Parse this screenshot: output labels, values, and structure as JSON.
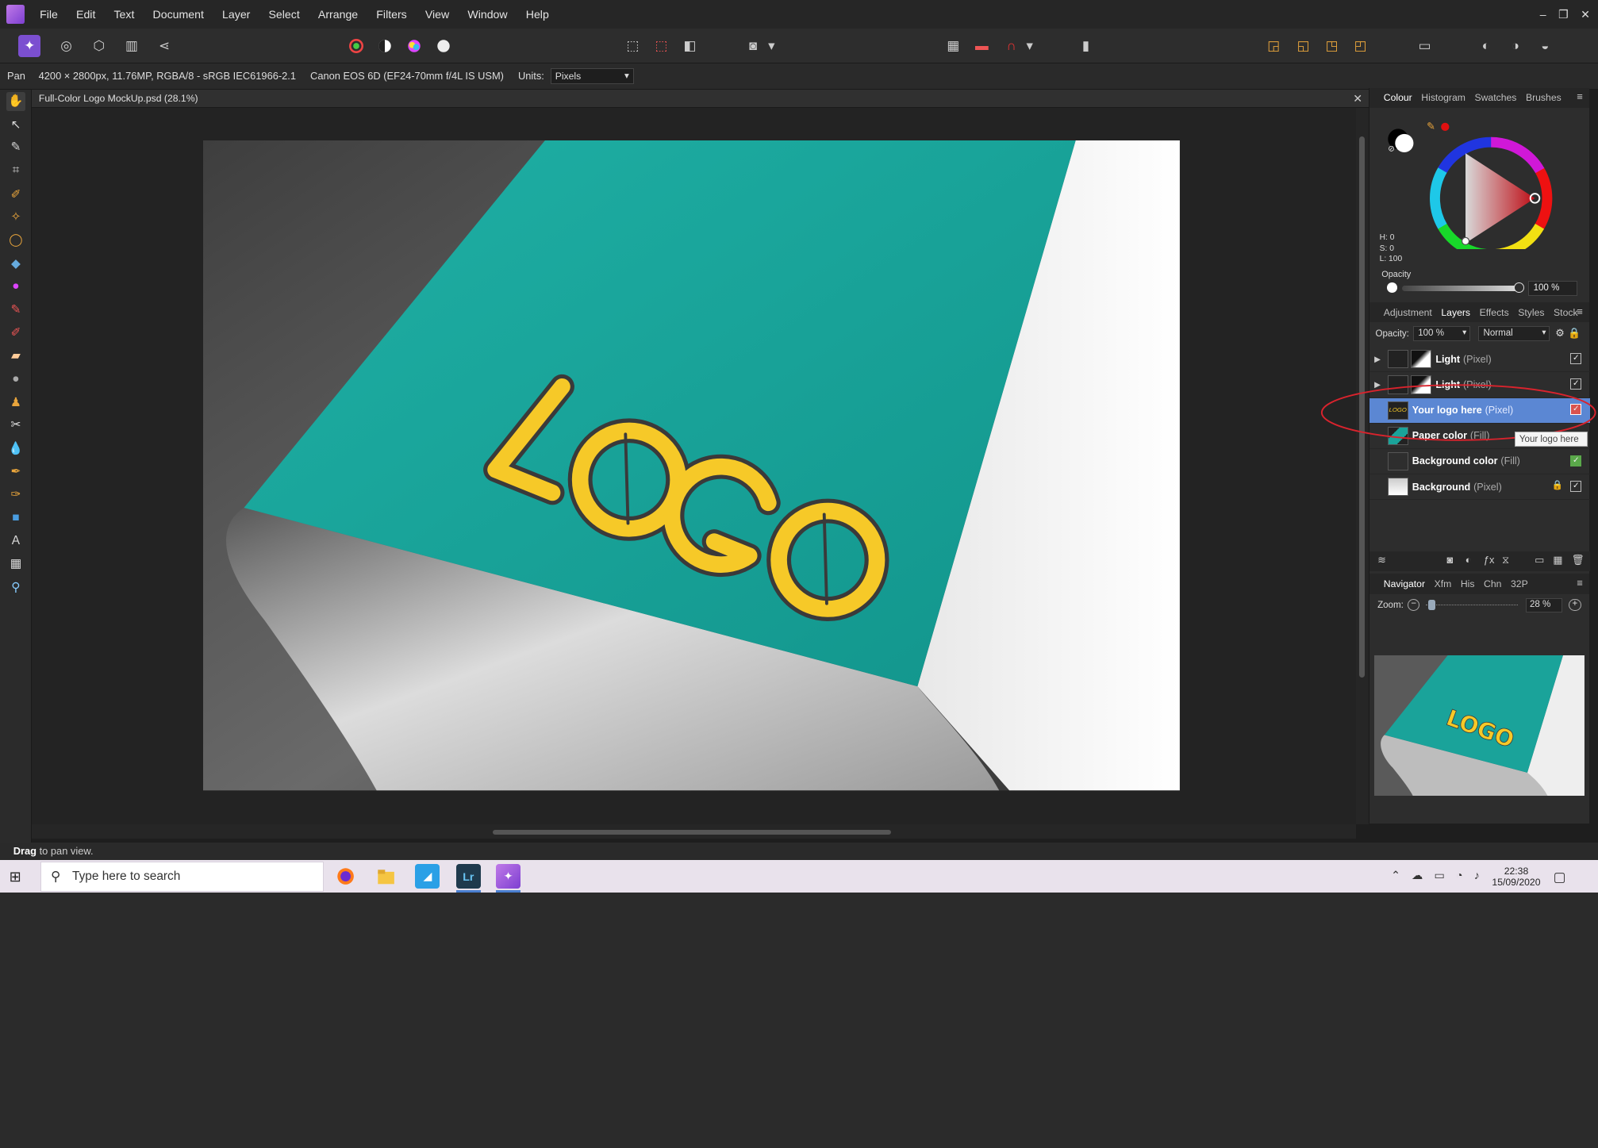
{
  "menu": [
    "File",
    "Edit",
    "Text",
    "Document",
    "Layer",
    "Select",
    "Arrange",
    "Filters",
    "View",
    "Window",
    "Help"
  ],
  "window_controls": [
    "–",
    "❐",
    "✕"
  ],
  "context": {
    "tool": "Pan",
    "doc_info": "4200 × 2800px, 11.76MP, RGBA/8 - sRGB IEC61966-2.1",
    "camera": "Canon EOS 6D (EF24-70mm f/4L IS USM)",
    "units_label": "Units:",
    "units_value": "Pixels"
  },
  "document": {
    "tab_title": "Full-Color Logo MockUp.psd (28.1%)",
    "close": "✕"
  },
  "canvas": {
    "logo_text": "LOGO",
    "paper_color": "#1aa39a",
    "logo_color": "#f6c928"
  },
  "colour_panel": {
    "tabs": [
      "Colour",
      "Histogram",
      "Swatches",
      "Brushes"
    ],
    "active_tab": "Colour",
    "h": "H: 0",
    "s": "S: 0",
    "l": "L: 100",
    "opacity_label": "Opacity",
    "opacity_value": "100 %"
  },
  "layers_panel": {
    "tabs": [
      "Adjustment",
      "Layers",
      "Effects",
      "Styles",
      "Stock"
    ],
    "active_tab": "Layers",
    "opacity_label": "Opacity:",
    "opacity_value": "100 %",
    "blend_mode": "Normal",
    "layers": [
      {
        "name": "Light",
        "type": "(Pixel)",
        "expandable": true,
        "checked": true
      },
      {
        "name": "Light",
        "type": "(Pixel)",
        "expandable": true,
        "checked": true,
        "struck": true
      },
      {
        "name": "Your logo here",
        "type": "(Pixel)",
        "selected": true,
        "checked": true
      },
      {
        "name": "Paper color",
        "type": "(Fill)",
        "checked": true
      },
      {
        "name": "Background color",
        "type": "(Fill)",
        "checked": true
      },
      {
        "name": "Background",
        "type": "(Pixel)",
        "locked": true,
        "checked": true
      }
    ],
    "tooltip": "Your logo here",
    "highlight_color": "#d9232d"
  },
  "navigator_panel": {
    "tabs": [
      "Navigator",
      "Xfm",
      "His",
      "Chn",
      "32P"
    ],
    "active_tab": "Navigator",
    "zoom_label": "Zoom:",
    "zoom_value": "28 %",
    "preview_logo_text": "LOGO"
  },
  "status": {
    "bold": "Drag",
    "rest": " to pan view."
  },
  "taskbar": {
    "search_placeholder": "Type here to search",
    "time": "22:38",
    "date": "15/09/2020",
    "apps": [
      "Firefox",
      "File Explorer",
      "Affinity Designer",
      "Lr",
      "Affinity Photo"
    ]
  }
}
